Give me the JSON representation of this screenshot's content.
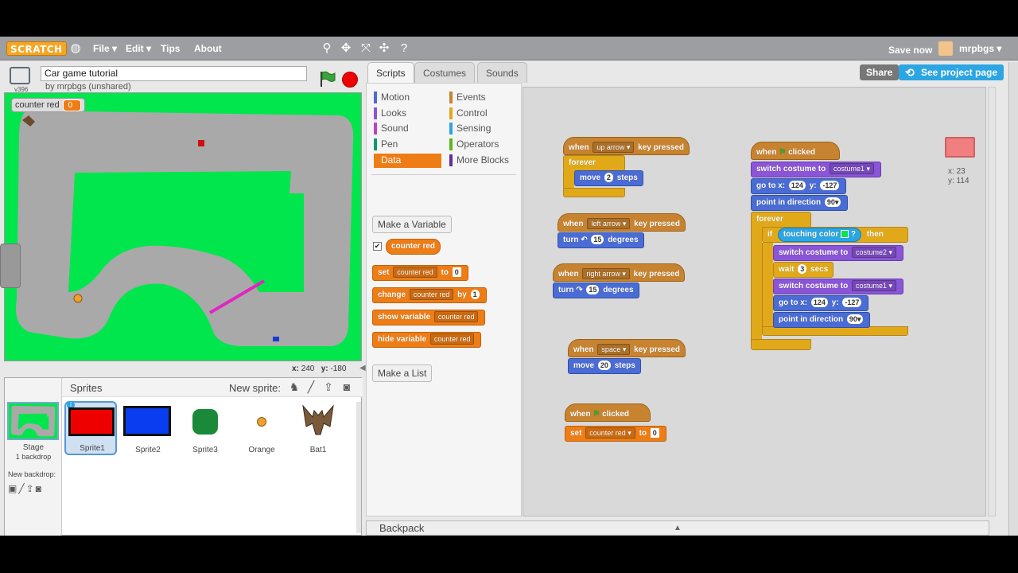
{
  "menu": {
    "logo": "SCRATCH",
    "items": [
      "File ▾",
      "Edit ▾",
      "Tips",
      "About"
    ],
    "save_now": "Save now",
    "username": "mrpbgs ▾"
  },
  "project": {
    "title": "Car game tutorial",
    "byline": "by mrpbgs (unshared)",
    "version": "v396",
    "share": "Share",
    "see_project_page": "See project page"
  },
  "stage": {
    "monitor_label": "counter red",
    "monitor_value": "0",
    "mouse_x_label": "x:",
    "mouse_x": "240",
    "mouse_y_label": "y:",
    "mouse_y": "-180"
  },
  "sprite_pane": {
    "header": "Sprites",
    "new_sprite": "New sprite:",
    "stage_label": "Stage",
    "backdrop_count": "1 backdrop",
    "new_backdrop": "New backdrop:",
    "sprites": [
      {
        "name": "Sprite1",
        "color": "#ee0000"
      },
      {
        "name": "Sprite2",
        "color": "#0a3df0"
      },
      {
        "name": "Sprite3",
        "color": "#1a8a3a"
      },
      {
        "name": "Orange",
        "color": "#f0a030"
      },
      {
        "name": "Bat1",
        "color": "#7a5a3a"
      }
    ]
  },
  "tabs": [
    "Scripts",
    "Costumes",
    "Sounds"
  ],
  "categories": {
    "left": [
      {
        "label": "Motion",
        "color": "#4a6cd4"
      },
      {
        "label": "Looks",
        "color": "#8a55d7"
      },
      {
        "label": "Sound",
        "color": "#bb42c3"
      },
      {
        "label": "Pen",
        "color": "#0e9a6c"
      },
      {
        "label": "Data",
        "color": "#ee7d16"
      }
    ],
    "right": [
      {
        "label": "Events",
        "color": "#c88330"
      },
      {
        "label": "Control",
        "color": "#e1a91a"
      },
      {
        "label": "Sensing",
        "color": "#2ca5e2"
      },
      {
        "label": "Operators",
        "color": "#5cb712"
      },
      {
        "label": "More Blocks",
        "color": "#632d99"
      }
    ]
  },
  "palette": {
    "make_variable": "Make a Variable",
    "variable_name": "counter red",
    "set_label": "set",
    "set_to": "to",
    "set_value": "0",
    "change_label": "change",
    "change_by": "by",
    "change_value": "1",
    "show_variable": "show variable",
    "hide_variable": "hide variable",
    "make_list": "Make a List"
  },
  "scripts": {
    "up": {
      "when": "when",
      "key": "up arrow ▾",
      "pressed": "key pressed",
      "forever": "forever",
      "move": "move",
      "steps_val": "2",
      "steps": "steps"
    },
    "left": {
      "when": "when",
      "key": "left arrow ▾",
      "pressed": "key pressed",
      "turn": "turn ↶",
      "deg_val": "15",
      "degrees": "degrees"
    },
    "right": {
      "when": "when",
      "key": "right arrow ▾",
      "pressed": "key pressed",
      "turn": "turn ↷",
      "deg_val": "15",
      "degrees": "degrees"
    },
    "space": {
      "when": "when",
      "key": "space ▾",
      "pressed": "key pressed",
      "move": "move",
      "steps_val": "20",
      "steps": "steps"
    },
    "flag1": {
      "when": "when",
      "clicked": "clicked",
      "set": "set",
      "var": "counter red ▾",
      "to": "to",
      "val": "0"
    },
    "flag2": {
      "when": "when",
      "clicked": "clicked",
      "switch_costume": "switch costume to",
      "costume1": "costume1 ▾",
      "goto": "go to x:",
      "x": "124",
      "y_label": "y:",
      "y": "-127",
      "point": "point in direction",
      "dir": "90▾",
      "forever": "forever",
      "if": "if",
      "touching_color": "touching color",
      "q": "?",
      "then": "then",
      "costume2": "costume2 ▾",
      "wait": "wait",
      "wait_val": "3",
      "secs": "secs"
    }
  },
  "sprite_info": {
    "x_label": "x:",
    "x": "23",
    "y_label": "y:",
    "y": "114"
  },
  "backpack": "Backpack",
  "colors": {
    "stage_grass": "#00e64c",
    "track": "#a9a9a9",
    "data_orange": "#ee7d16",
    "share_blue": "#2ca5e2"
  }
}
